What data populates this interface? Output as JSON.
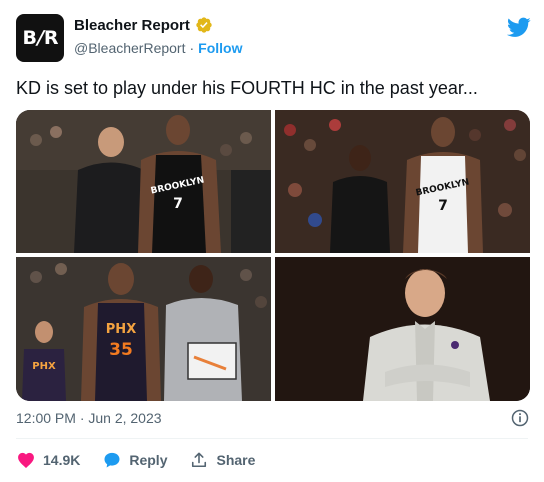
{
  "account": {
    "avatar_text_left": "B",
    "avatar_text_slash": "/",
    "avatar_text_right": "R",
    "display_name": "Bleacher Report",
    "handle": "@BleacherReport",
    "separator": "·",
    "follow_label": "Follow"
  },
  "tweet": {
    "text": "KD is set to play under his FOURTH HC in the past year...",
    "timestamp": "12:00 PM · Jun 2, 2023"
  },
  "actions": {
    "likes_count": "14.9K",
    "reply_label": "Reply",
    "share_label": "Share"
  },
  "photos": {
    "p1": {
      "jersey_text": "BROOKLYN",
      "jersey_number": "7"
    },
    "p2": {
      "jersey_text": "BROOKLYN",
      "jersey_number": "7"
    },
    "p3": {
      "jersey_text": "PHX",
      "jersey_number": "35",
      "jersey_text_small": "PHX"
    },
    "p4": {}
  },
  "colors": {
    "accent": "#1d9bf0",
    "like": "#f91880",
    "verified": "#e2b719",
    "text_secondary": "#536471"
  }
}
